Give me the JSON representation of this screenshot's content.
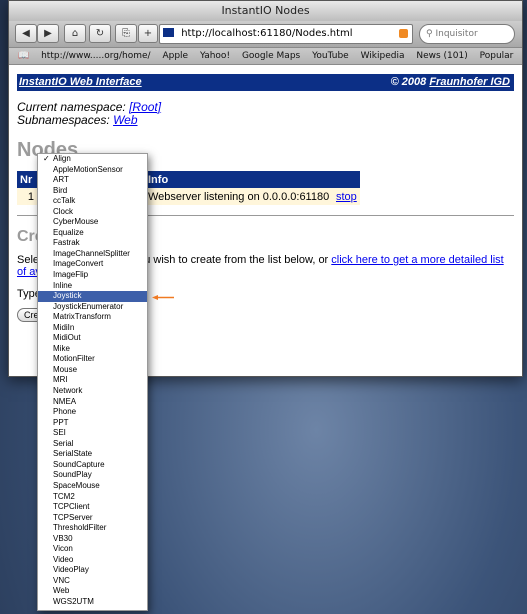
{
  "window": {
    "title": "InstantIO Nodes"
  },
  "toolbar": {
    "url": "http://localhost:61180/Nodes.html",
    "search_placeholder": "Inquisitor"
  },
  "bookmarks": [
    "http://www.....org/home/",
    "Apple",
    "Yahoo!",
    "Google Maps",
    "YouTube",
    "Wikipedia",
    "News (101)",
    "Popular"
  ],
  "page": {
    "header_left": "InstantIO Web Interface",
    "header_right_prefix": "© 2008 ",
    "header_right_link": "Fraunhofer IGD",
    "namespace_label": "Current namespace: ",
    "namespace_value": "[Root]",
    "subnamespaces_label": "Subnamespaces: ",
    "subnamespaces_value": "Web",
    "nodes_title": "Nodes",
    "table": {
      "headers": [
        "Nr",
        "",
        "Info",
        ""
      ],
      "row": {
        "nr": "1",
        "info": "Webserver listening on 0.0.0.0:61180",
        "action": "stop"
      }
    },
    "create_title": "Create new node",
    "select_text": "Select the type of node you wish to create from the list below, or ",
    "select_link": "click here to get a more detailed list of available nodes",
    "type_label": "Type",
    "create_button": "Create"
  },
  "dropdown": {
    "selected": "Align",
    "highlighted": "Joystick",
    "items": [
      "Align",
      "AppleMotionSensor",
      "ART",
      "Bird",
      "ccTalk",
      "Clock",
      "CyberMouse",
      "Equalize",
      "Fastrak",
      "ImageChannelSplitter",
      "ImageConvert",
      "ImageFlip",
      "Inline",
      "Joystick",
      "JoystickEnumerator",
      "MatrixTransform",
      "MidiIn",
      "MidiOut",
      "Mike",
      "MotionFilter",
      "Mouse",
      "MRI",
      "Network",
      "NMEA",
      "Phone",
      "PPT",
      "SEI",
      "Serial",
      "SerialState",
      "SoundCapture",
      "SoundPlay",
      "SpaceMouse",
      "TCM2",
      "TCPClient",
      "TCPServer",
      "ThresholdFilter",
      "VB30",
      "Vicon",
      "Video",
      "VideoPlay",
      "VNC",
      "Web",
      "WGS2UTM"
    ]
  }
}
